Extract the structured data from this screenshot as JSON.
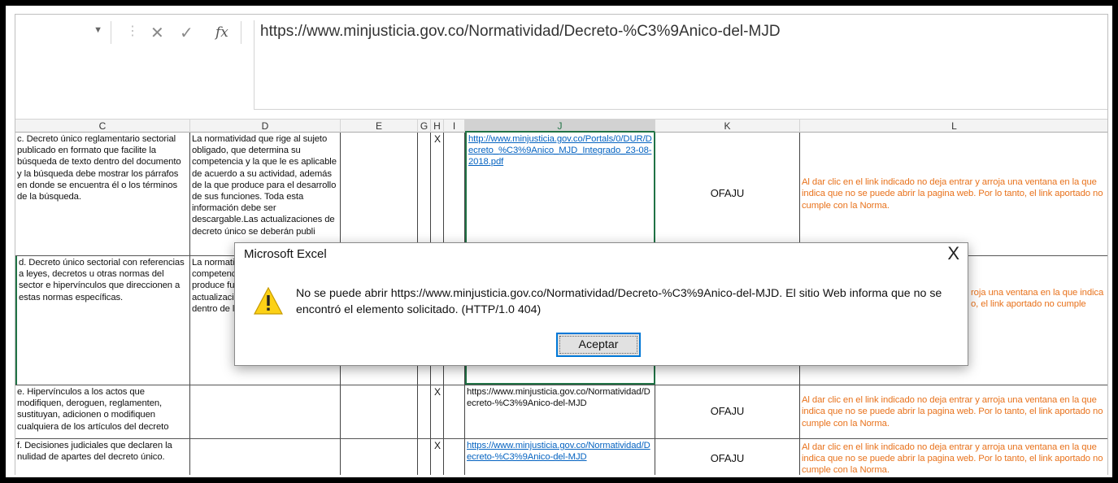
{
  "formula_bar": {
    "cancel_glyph": "✕",
    "enter_glyph": "✓",
    "fx_glyph": "fx",
    "value": "https://www.minjusticia.gov.co/Normatividad/Decreto-%C3%9Anico-del-MJD"
  },
  "columns": [
    "C",
    "D",
    "E",
    "G",
    "H",
    "I",
    "J",
    "K",
    "L"
  ],
  "rows": [
    {
      "c": "c. Decreto único reglamentario sectorial publicado en formato que facilite la búsqueda de texto dentro del documento y la búsqueda debe mostrar los párrafos en donde se encuentra él o los términos de la búsqueda.",
      "d": "La normatividad que rige al sujeto obligado, que determina su competencia y la que le es aplicable de acuerdo a su actividad, además de la que produce para el desarrollo de sus funciones. Toda esta información debe ser descargable.Las actualizaciones de decreto único se deberán publi",
      "h": "X",
      "j": "http://www.minjusticia.gov.co/Portals/0/DUR/Decreto_%C3%9Anico_MJD_Integrado_23-08-2018.pdf",
      "k": "OFAJU",
      "l": "Al dar clic en el link indicado no deja entrar y arroja una ventana en la que indica que no se puede abrir la pagina web. Por lo tanto, el link aportado no cumple con la Norma."
    },
    {
      "c": "d. Decreto único sectorial con referencias a leyes, decretos u otras normas del sector e hipervínculos que direccionen a estas normas específicas.",
      "d": "La normativid obligado, que competencia acuerdo a su que produce funciones.To debe ser desc actualizacion deberán publicar dentro de los",
      "h": "",
      "j": "",
      "k": "",
      "l": "roja una ventana en la que indica o, el link aportado no cumple"
    },
    {
      "c": "e. Hipervínculos a los actos que modifiquen, deroguen, reglamenten, sustituyan, adicionen o modifiquen cualquiera de los artículos del decreto",
      "d": "",
      "h": "X",
      "j": "https://www.minjusticia.gov.co/Normatividad/Decreto-%C3%9Anico-del-MJD",
      "k": "OFAJU",
      "l": "Al dar clic en el link indicado no deja entrar y arroja una ventana en la que indica que no se puede abrir la pagina web. Por lo tanto, el link aportado no cumple con la Norma."
    },
    {
      "c": "f. Decisiones judiciales que declaren la nulidad de apartes del decreto único.",
      "d": "",
      "h": "X",
      "j": "https://www.minjusticia.gov.co/Normatividad/Decreto-%C3%9Anico-del-MJD",
      "k": "OFAJU",
      "l": "Al dar clic en el link indicado no deja entrar y arroja una ventana en la que indica que no se puede abrir la pagina web. Por lo tanto, el link aportado no cumple con la Norma."
    }
  ],
  "dialog": {
    "title": "Microsoft Excel",
    "close_glyph": "X",
    "message": "No se puede abrir https://www.minjusticia.gov.co/Normatividad/Decreto-%C3%9Anico-del-MJD. El sitio Web informa que no se encontró el elemento solicitado. (HTTP/1.0 404)",
    "ok_label": "Aceptar",
    "icon": "warning-icon"
  }
}
